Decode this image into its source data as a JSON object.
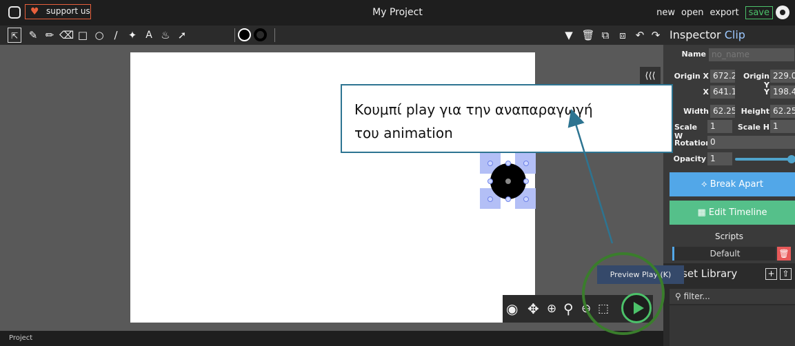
{
  "app": {
    "title": "My Project",
    "support_label": "support us"
  },
  "menu": {
    "new": "new",
    "open": "open",
    "export": "export",
    "save": "save"
  },
  "toolbar": {
    "tools": [
      "cursor-tool-icon",
      "brush-icon",
      "pencil-icon",
      "eraser-icon",
      "rectangle-icon",
      "ellipse-icon",
      "line-icon",
      "path-icon",
      "text-icon",
      "fill-bucket-icon",
      "eyedropper-icon"
    ]
  },
  "inspector": {
    "title": "Inspector",
    "subtitle": "Clip",
    "name_label": "Name",
    "name_placeholder": "no_name",
    "origin_x_label": "Origin X",
    "origin_x": "672.2",
    "origin_y_label": "Origin Y",
    "origin_y": "229.0",
    "x_label": "X",
    "x": "641.1",
    "y_label": "Y",
    "y": "198.4",
    "width_label": "Width",
    "width": "62.25",
    "height_label": "Height",
    "height": "62.25",
    "scale_w_label": "Scale W",
    "scale_w": "1",
    "scale_h_label": "Scale H",
    "scale_h": "1",
    "rotation_label": "Rotation",
    "rotation": "0",
    "opacity_label": "Opacity",
    "opacity": "1",
    "break_apart": "Break Apart",
    "edit_timeline": "Edit Timeline",
    "scripts_title": "Scripts",
    "script_default": "Default"
  },
  "assets": {
    "title": "Asset Library",
    "filter_placeholder": "filter..."
  },
  "annotation": {
    "line1": "Κουμπί play για την αναπαραγωγή",
    "line2": "του animation"
  },
  "tooltip": "Preview Play (K)",
  "bottom": {
    "tab": "Project"
  },
  "colors": {
    "accent_green": "#4cc26a",
    "accent_blue": "#52a7e8",
    "support_orange": "#e8603c",
    "annotation_circle": "#3a7d2c",
    "annotation_arrow": "#2d7491"
  }
}
